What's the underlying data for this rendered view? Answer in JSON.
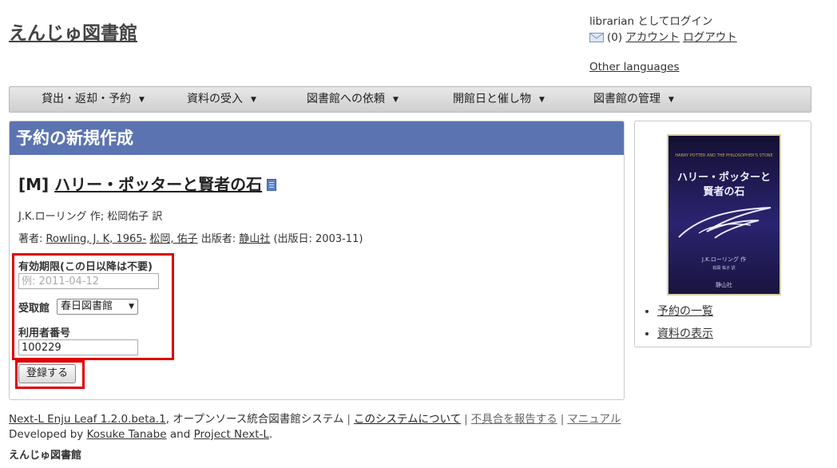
{
  "header": {
    "site_title": "えんじゅ図書館",
    "login_text": "librarian としてログイン",
    "message_count": "(0)",
    "account_link": "アカウント",
    "logout_link": "ログアウト",
    "other_languages": "Other languages"
  },
  "nav": {
    "items": [
      {
        "label": "貸出・返却・予約"
      },
      {
        "label": "資料の受入"
      },
      {
        "label": "図書館への依頼"
      },
      {
        "label": "開館日と催し物"
      },
      {
        "label": "図書館の管理"
      }
    ]
  },
  "main": {
    "heading": "予約の新規作成",
    "title_prefix": "[M]",
    "title": "ハリー・ポッターと賢者の石",
    "author_line": "J.K.ローリング 作; 松岡佑子 訳",
    "creator_label": "著者:",
    "creator_1": "Rowling, J. K, 1965-",
    "creator_2": "松岡, 佑子",
    "publisher_label": "出版者:",
    "publisher": "静山社",
    "pub_date": "(出版日: 2003-11)",
    "form": {
      "expiry_label": "有効期限(この日以降は不要)",
      "expiry_placeholder": "例: 2011-04-12",
      "expiry_value": "",
      "pickup_label": "受取館",
      "pickup_selected": "春日図書館",
      "user_number_label": "利用者番号",
      "user_number_value": "100229",
      "submit_label": "登録する"
    }
  },
  "side": {
    "cover": {
      "top_text": "HARRY POTTER AND THE PHILOSOPHER'S STONE",
      "title_line1": "ハリー・ポッターと",
      "title_line2": "賢者の石",
      "author": "J.K.ローリング 作",
      "translator": "松岡 佑子 訳",
      "publisher": "静山社"
    },
    "links": [
      "予約の一覧",
      "資料の表示"
    ]
  },
  "footer": {
    "product_link": "Next-L Enju Leaf 1.2.0.beta.1",
    "product_desc": ", オープンソース統合図書館システム",
    "about_link": "このシステムについて",
    "report_link": "不具合を報告する",
    "manual_link": "マニュアル",
    "developed_by": "Developed by",
    "dev_name": "Kosuke Tanabe",
    "and": "and",
    "project": "Project Next-L",
    "period": ".",
    "library_name": "えんじゅ図書館"
  }
}
